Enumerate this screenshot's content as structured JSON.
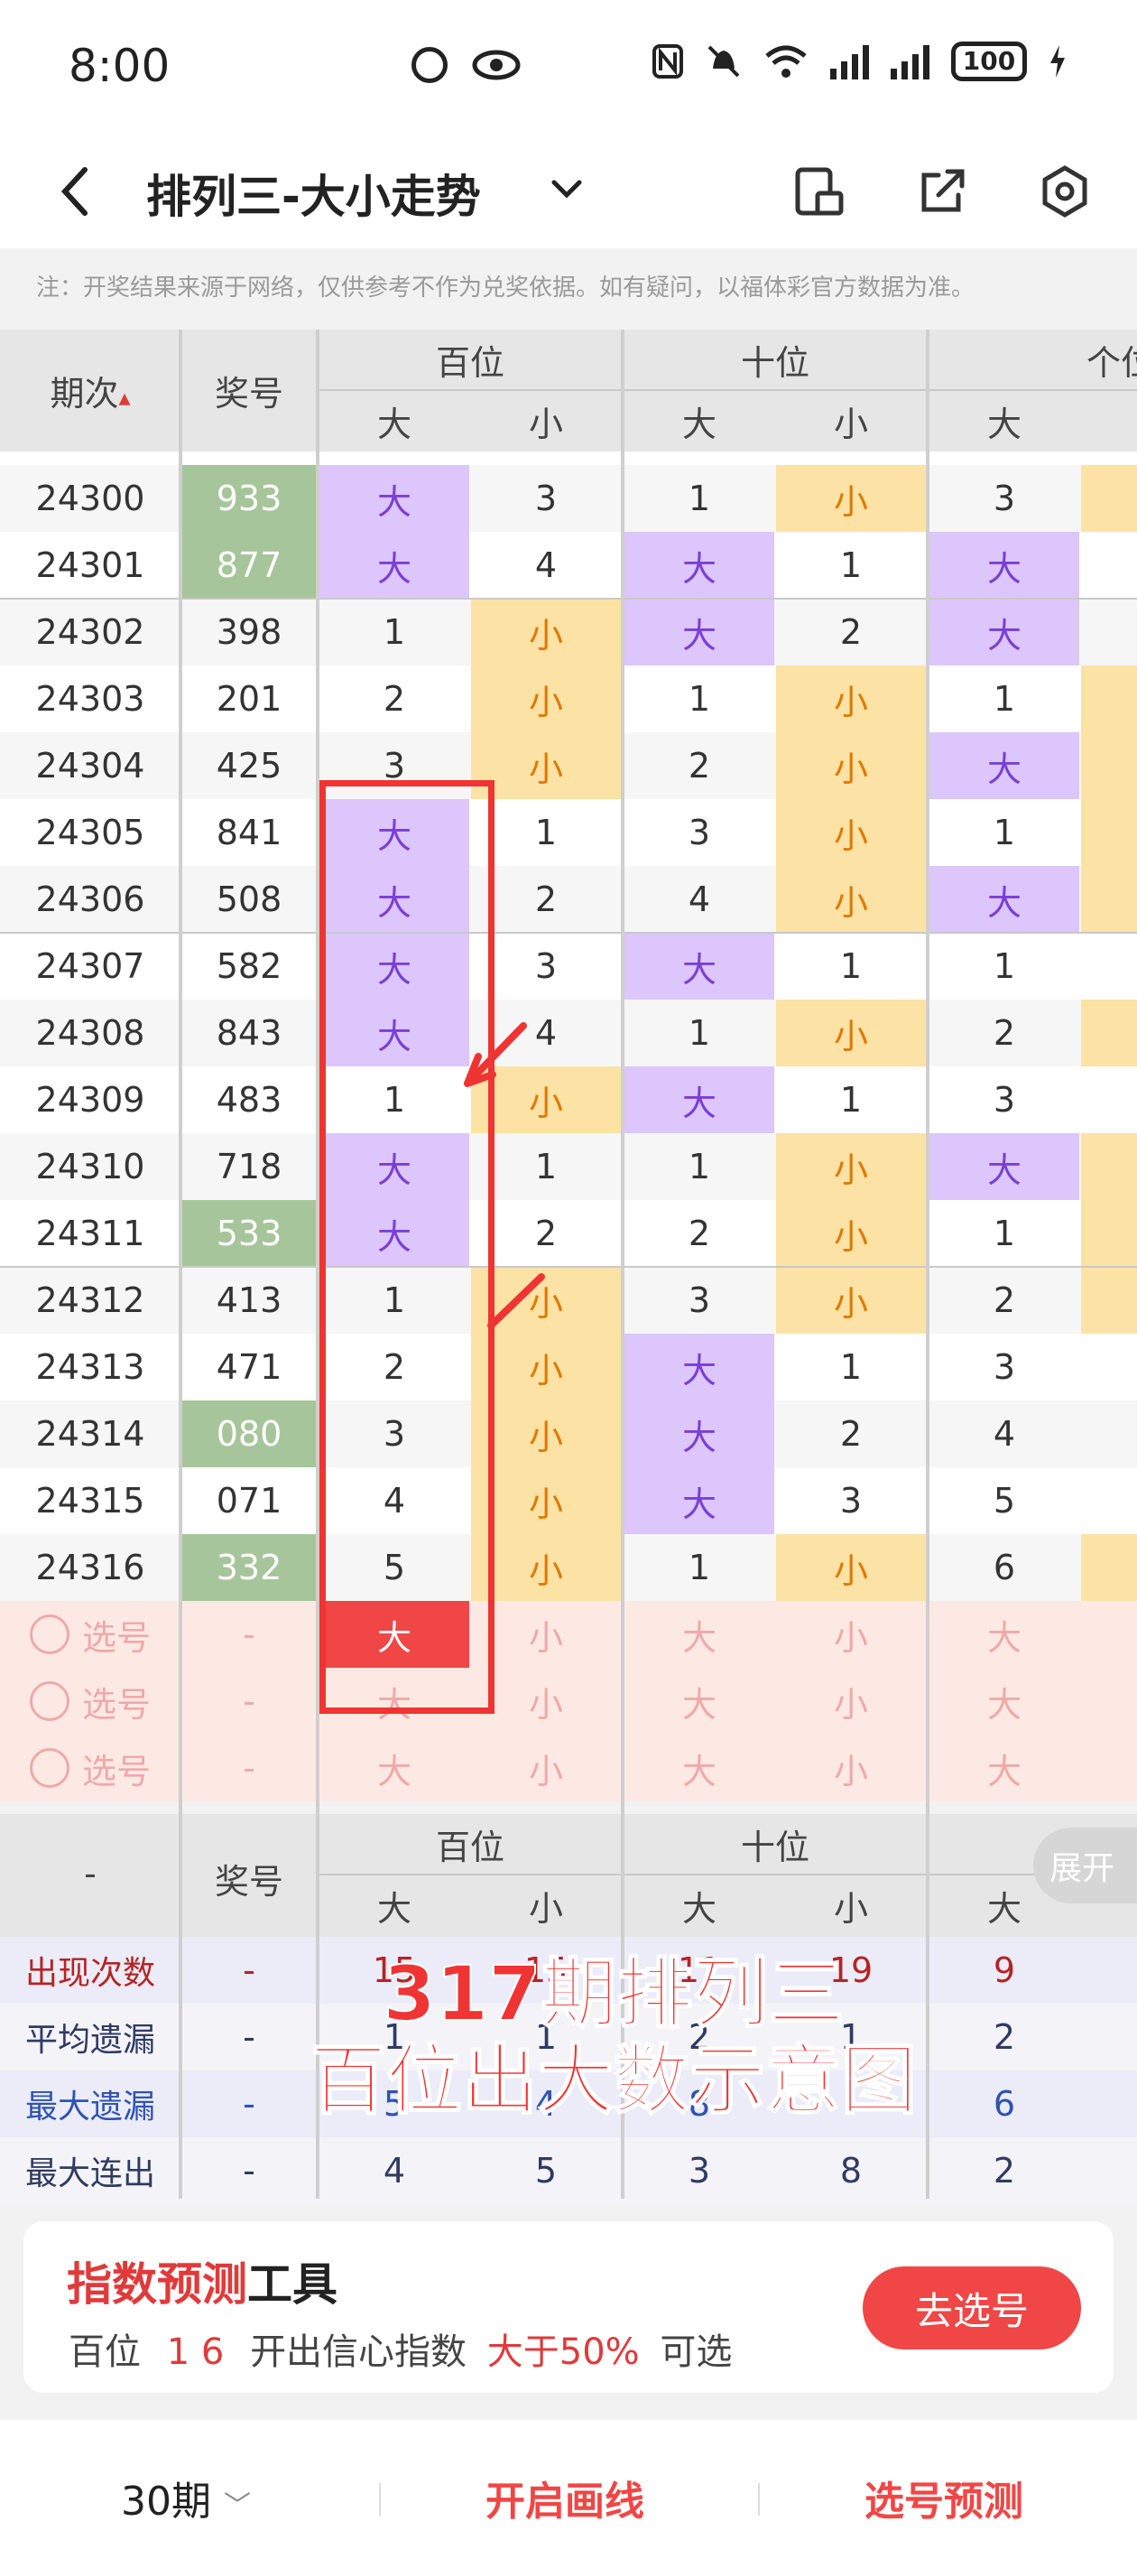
{
  "status": {
    "time": "8:00",
    "battery": "100"
  },
  "header": {
    "title": "排列三-大小走势"
  },
  "note": "注：开奖结果来源于网络，仅供参考不作为兑奖依据。如有疑问，以福体彩官方数据为准。",
  "table_header": {
    "issue": "期次",
    "prize": "奖号",
    "groups": [
      "百位",
      "十位",
      "个位"
    ],
    "sub": [
      "大",
      "小",
      "大",
      "小",
      "大"
    ]
  },
  "rows": [
    {
      "issue": "24300",
      "prize": "933",
      "hot": true,
      "cells": [
        "大",
        "3",
        "1",
        "小",
        "3"
      ]
    },
    {
      "issue": "24301",
      "prize": "877",
      "hot": true,
      "cells": [
        "大",
        "4",
        "大",
        "1",
        "大"
      ]
    },
    {
      "issue": "24302",
      "prize": "398",
      "hot": false,
      "cells": [
        "1",
        "小",
        "大",
        "2",
        "大"
      ]
    },
    {
      "issue": "24303",
      "prize": "201",
      "hot": false,
      "cells": [
        "2",
        "小",
        "1",
        "小",
        "1"
      ]
    },
    {
      "issue": "24304",
      "prize": "425",
      "hot": false,
      "cells": [
        "3",
        "小",
        "2",
        "小",
        "大"
      ]
    },
    {
      "issue": "24305",
      "prize": "841",
      "hot": false,
      "cells": [
        "大",
        "1",
        "3",
        "小",
        "1"
      ]
    },
    {
      "issue": "24306",
      "prize": "508",
      "hot": false,
      "cells": [
        "大",
        "2",
        "4",
        "小",
        "大"
      ]
    },
    {
      "issue": "24307",
      "prize": "582",
      "hot": false,
      "cells": [
        "大",
        "3",
        "大",
        "1",
        "1"
      ]
    },
    {
      "issue": "24308",
      "prize": "843",
      "hot": false,
      "cells": [
        "大",
        "4",
        "1",
        "小",
        "2"
      ]
    },
    {
      "issue": "24309",
      "prize": "483",
      "hot": false,
      "cells": [
        "1",
        "小",
        "大",
        "1",
        "3"
      ]
    },
    {
      "issue": "24310",
      "prize": "718",
      "hot": false,
      "cells": [
        "大",
        "1",
        "1",
        "小",
        "大"
      ]
    },
    {
      "issue": "24311",
      "prize": "533",
      "hot": true,
      "cells": [
        "大",
        "2",
        "2",
        "小",
        "1"
      ]
    },
    {
      "issue": "24312",
      "prize": "413",
      "hot": false,
      "cells": [
        "1",
        "小",
        "3",
        "小",
        "2"
      ]
    },
    {
      "issue": "24313",
      "prize": "471",
      "hot": false,
      "cells": [
        "2",
        "小",
        "大",
        "1",
        "3"
      ]
    },
    {
      "issue": "24314",
      "prize": "080",
      "hot": true,
      "cells": [
        "3",
        "小",
        "大",
        "2",
        "4"
      ]
    },
    {
      "issue": "24315",
      "prize": "071",
      "hot": false,
      "cells": [
        "4",
        "小",
        "大",
        "3",
        "5"
      ]
    },
    {
      "issue": "24316",
      "prize": "332",
      "hot": true,
      "cells": [
        "5",
        "小",
        "1",
        "小",
        "6"
      ]
    }
  ],
  "pick_rows": [
    {
      "label": "选号",
      "prize": "-",
      "cells": [
        "大",
        "小",
        "大",
        "小",
        "大"
      ],
      "first_selected": true
    },
    {
      "label": "选号",
      "prize": "-",
      "cells": [
        "大",
        "小",
        "大",
        "小",
        "大"
      ],
      "first_selected": false
    },
    {
      "label": "选号",
      "prize": "-",
      "cells": [
        "大",
        "小",
        "大",
        "小",
        "大"
      ],
      "first_selected": false
    }
  ],
  "stats_header": {
    "issue": "-",
    "prize": "奖号",
    "groups": [
      "百位",
      "十位"
    ],
    "sub": [
      "大",
      "小",
      "大",
      "小",
      "大"
    ],
    "expand": "展开"
  },
  "stats": [
    {
      "label": "出现次数",
      "style": "red",
      "prize": "-",
      "cells": [
        "15",
        "15",
        "11",
        "19",
        "9"
      ]
    },
    {
      "label": "平均遗漏",
      "style": "dark",
      "prize": "-",
      "cells": [
        "1",
        "1",
        "2",
        "1",
        "2"
      ]
    },
    {
      "label": "最大遗漏",
      "style": "blue",
      "prize": "-",
      "cells": [
        "5",
        "4",
        "8",
        "",
        "6"
      ]
    },
    {
      "label": "最大连出",
      "style": "dark",
      "prize": "-",
      "cells": [
        "4",
        "5",
        "3",
        "8",
        "2"
      ]
    }
  ],
  "overlay": {
    "line1": "317期排列三",
    "line2": "百位出大数示意图"
  },
  "tool": {
    "title_red": "指数预测",
    "title_black": "工具",
    "desc_pos": "百位",
    "desc_nums": "1 6",
    "desc_mid": "开出信心指数",
    "desc_red": "大于50%",
    "desc_end": "可选",
    "button": "去选号"
  },
  "bottom": {
    "periods": "30期",
    "draw_line": "开启画线",
    "predict": "选号预测"
  },
  "colors": {
    "big_bg": "#dcc6fb",
    "small_bg": "#fde2a6",
    "hot_bg": "#a7c59a",
    "accent": "#f04646"
  }
}
